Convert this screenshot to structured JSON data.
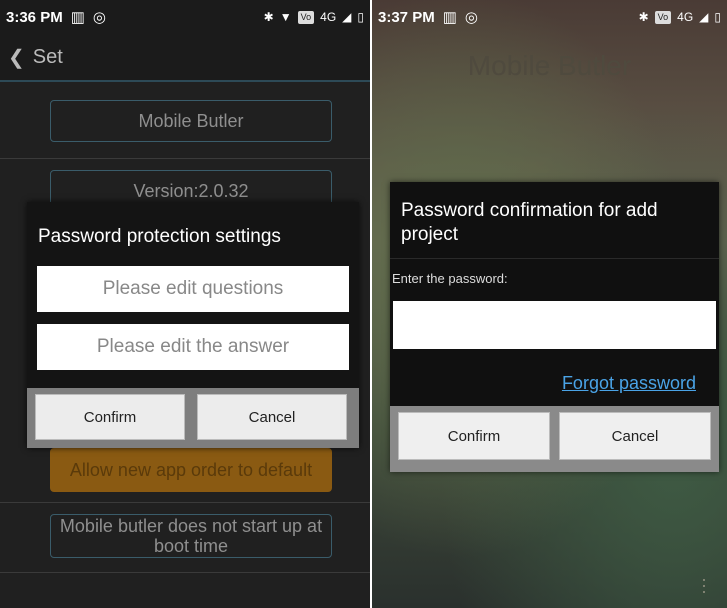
{
  "left": {
    "status": {
      "time": "3:36 PM",
      "net": "4G"
    },
    "nav": {
      "title": "Set"
    },
    "settings": [
      {
        "label": "Mobile Butler"
      },
      {
        "label": "Version:2.0.32"
      },
      {
        "label": "Allow new app order to default"
      },
      {
        "label": "Mobile butler does not start up at boot time"
      }
    ],
    "dialog": {
      "title": "Password protection settings",
      "question_placeholder": "Please edit questions",
      "answer_placeholder": "Please edit the answer",
      "confirm": "Confirm",
      "cancel": "Cancel"
    }
  },
  "right": {
    "status": {
      "time": "3:37 PM",
      "net": "4G"
    },
    "app_title": "Mobile Butler",
    "dialog": {
      "title": "Password confirmation for add project",
      "label": "Enter the password:",
      "input_value": "",
      "forgot": "Forgot password",
      "confirm": "Confirm",
      "cancel": "Cancel"
    }
  }
}
